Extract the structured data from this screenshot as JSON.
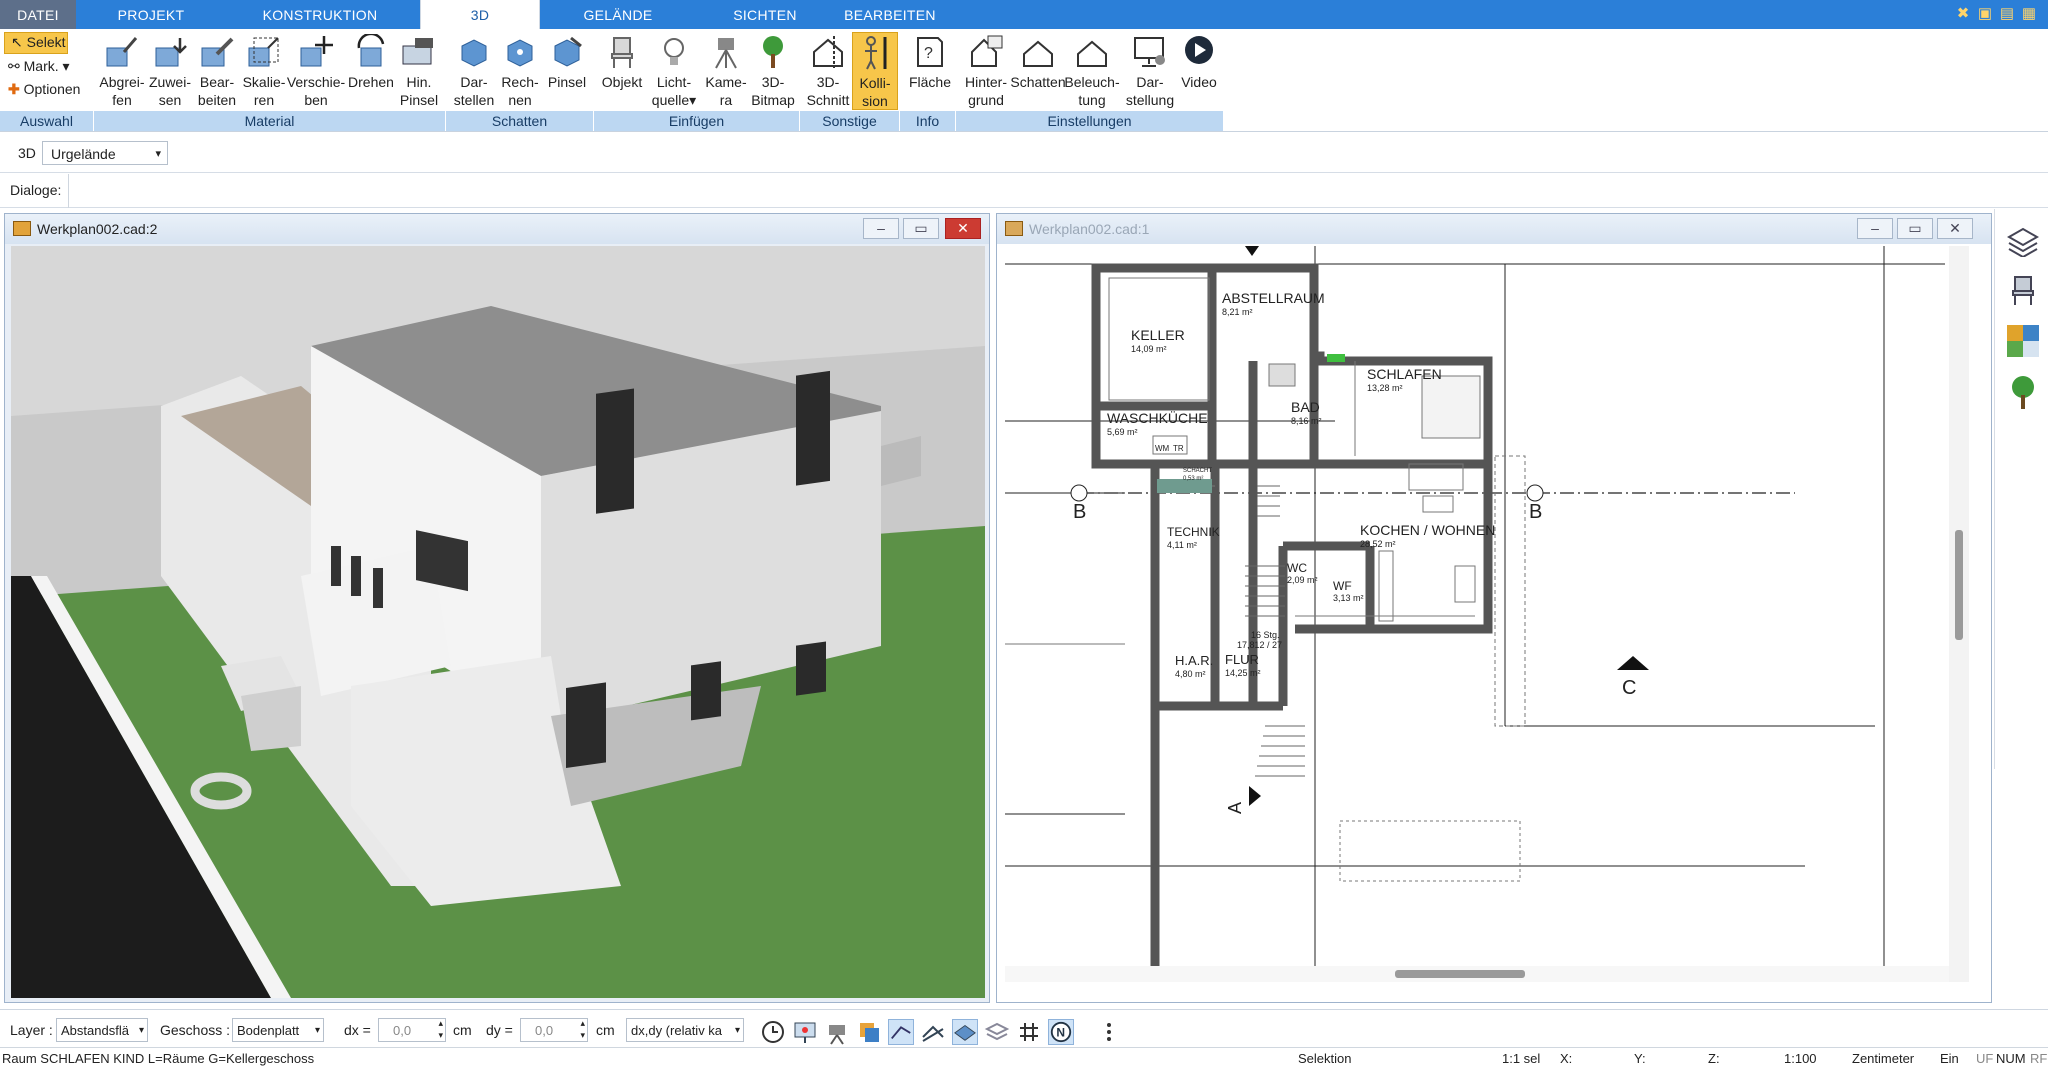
{
  "tabs": [
    {
      "label": "DATEI"
    },
    {
      "label": "PROJEKT"
    },
    {
      "label": "KONSTRUKTION"
    },
    {
      "label": "3D"
    },
    {
      "label": "GELÄNDE"
    },
    {
      "label": "SICHTEN"
    },
    {
      "label": "BEARBEITEN"
    }
  ],
  "selection": {
    "selekt": "Selekt",
    "mark": "Mark.",
    "optionen": "Optionen"
  },
  "ribbon": {
    "buttons": [
      {
        "l1": "Abgrei-",
        "l2": "fen"
      },
      {
        "l1": "Zuwei-",
        "l2": "sen"
      },
      {
        "l1": "Bear-",
        "l2": "beiten"
      },
      {
        "l1": "Skalie-",
        "l2": "ren"
      },
      {
        "l1": "Verschie-",
        "l2": "ben"
      },
      {
        "l1": "Drehen",
        "l2": ""
      },
      {
        "l1": "Hin.",
        "l2": "Pinsel"
      },
      {
        "l1": "Dar-",
        "l2": "stellen"
      },
      {
        "l1": "Rech-",
        "l2": "nen"
      },
      {
        "l1": "Pinsel",
        "l2": ""
      },
      {
        "l1": "Objekt",
        "l2": ""
      },
      {
        "l1": "Licht-",
        "l2": "quelle"
      },
      {
        "l1": "Kame-",
        "l2": "ra"
      },
      {
        "l1": "3D-",
        "l2": "Bitmap"
      },
      {
        "l1": "3D-",
        "l2": "Schnitt"
      },
      {
        "l1": "Kolli-",
        "l2": "sion"
      },
      {
        "l1": "Fläche",
        "l2": ""
      },
      {
        "l1": "Hinter-",
        "l2": "grund"
      },
      {
        "l1": "Schatten",
        "l2": ""
      },
      {
        "l1": "Beleuch-",
        "l2": "tung"
      },
      {
        "l1": "Dar-",
        "l2": "stellung"
      },
      {
        "l1": "Video",
        "l2": ""
      }
    ],
    "groups": [
      {
        "label": "Auswahl"
      },
      {
        "label": "Material"
      },
      {
        "label": "Schatten"
      },
      {
        "label": "Einfügen"
      },
      {
        "label": "Sonstige"
      },
      {
        "label": "Info"
      },
      {
        "label": "Einstellungen"
      }
    ]
  },
  "subbar": {
    "mode": "3D",
    "terrain": "Urgelände",
    "dialoge": "Dialoge:"
  },
  "windows": {
    "left": {
      "title": "Werkplan002.cad:2"
    },
    "right": {
      "title": "Werkplan002.cad:1"
    }
  },
  "plan": {
    "rooms": [
      {
        "name": "ABSTELLRAUM",
        "area": "8,21 m²"
      },
      {
        "name": "KELLER",
        "area": "14,09 m²"
      },
      {
        "name": "SCHLAFEN",
        "area": "13,28 m²"
      },
      {
        "name": "BAD",
        "area": "8,16 m²"
      },
      {
        "name": "WASCHKÜCHE",
        "area": "5,69 m²"
      },
      {
        "name": "TECHNIK",
        "area": "4,11 m²"
      },
      {
        "name": "KOCHEN / WOHNEN",
        "area": "28,52 m²"
      },
      {
        "name": "WC",
        "area": "2,09 m²"
      },
      {
        "name": "WF",
        "area": "3,13 m²"
      },
      {
        "name": "H.A.R.",
        "area": "4,80 m²"
      },
      {
        "name": "FLUR",
        "area": "14,25 m²"
      }
    ],
    "wm": "WM",
    "tr": "TR",
    "schacht": "SCHACHT",
    "schacht_area": "0,53 m²",
    "stairs": "16 Stg.",
    "stairs_dim": "17,812 / 27",
    "marker_b": "B",
    "marker_c": "C",
    "marker_a": "A"
  },
  "bottom": {
    "layer_label": "Layer :",
    "layer_value": "Abstandsflä",
    "geschoss_label": "Geschoss :",
    "geschoss_value": "Bodenplatt",
    "dx_label": "dx =",
    "dx_value": "0,0",
    "dy_label": "dy =",
    "dy_value": "0,0",
    "unit": "cm",
    "mode_value": "dx,dy (relativ ka"
  },
  "status": {
    "info": "Raum SCHLAFEN KIND L=Räume G=Kellergeschoss",
    "selektion": "Selektion",
    "sel": "1:1 sel",
    "x": "X:",
    "y": "Y:",
    "z": "Z:",
    "scale": "1:100",
    "units": "Zentimeter",
    "ein": "Ein",
    "uf": "UF",
    "num": "NUM",
    "rf": "RF"
  },
  "colors": {
    "tabbar": "#2b7fd8",
    "active_button": "#f7c64a",
    "group_bg": "#bcd7f2",
    "close": "#cc3b32",
    "grass": "#5c9147"
  }
}
